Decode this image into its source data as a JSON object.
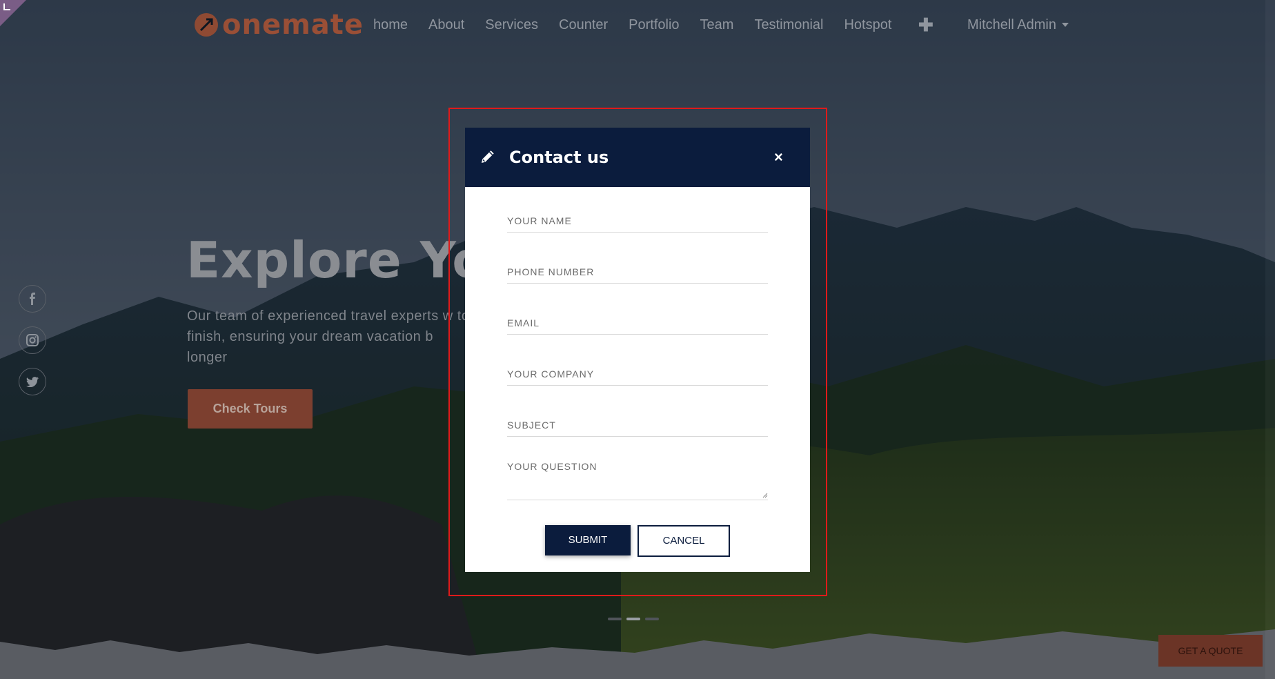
{
  "nav": {
    "brand": "onemate",
    "items": [
      {
        "label": "home"
      },
      {
        "label": "About"
      },
      {
        "label": "Services"
      },
      {
        "label": "Counter"
      },
      {
        "label": "Portfolio"
      },
      {
        "label": "Team"
      },
      {
        "label": "Testimonial"
      },
      {
        "label": "Hotspot"
      }
    ],
    "plus": "✚",
    "user": "Mitchell Admin"
  },
  "hero": {
    "title": "Explore You",
    "text": "Our team of experienced travel experts w to finish, ensuring your dream vacation b longer",
    "button": "Check Tours"
  },
  "social": [
    "facebook-icon",
    "instagram-icon",
    "twitter-icon"
  ],
  "quote_button": "GET A QUOTE",
  "modal": {
    "title": "Contact us",
    "close": "×",
    "fields": {
      "name": "YOUR NAME",
      "phone": "PHONE NUMBER",
      "email": "EMAIL",
      "company": "YOUR COMPANY",
      "subject": "SUBJECT",
      "question": "YOUR QUESTION"
    },
    "submit": "SUBMIT",
    "cancel": "CANCEL"
  },
  "colors": {
    "modal_header": "#0b1c3d",
    "brand": "#9a4f36",
    "highlight": "#e01a1a"
  }
}
